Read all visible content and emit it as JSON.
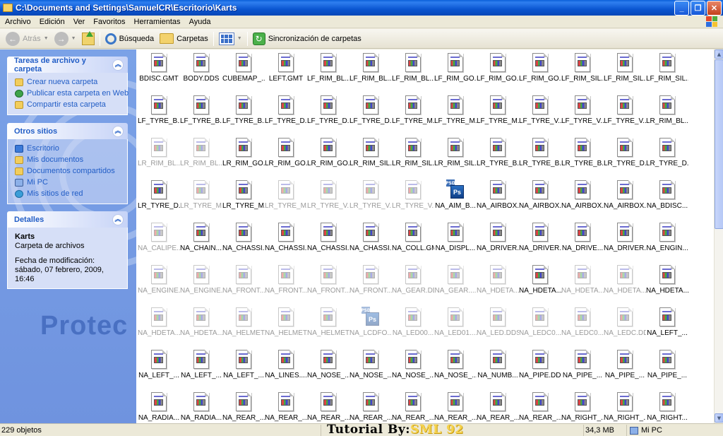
{
  "window": {
    "title": "C:\\Documents and Settings\\SamuelCR\\Escritorio\\Karts",
    "buttons": {
      "minimize": "_",
      "maximize": "❐",
      "close": "✕"
    }
  },
  "menu": [
    "Archivo",
    "Edición",
    "Ver",
    "Favoritos",
    "Herramientas",
    "Ayuda"
  ],
  "toolbar": {
    "back": "Atrás",
    "search": "Búsqueda",
    "folders": "Carpetas",
    "sync": "Sincronización de carpetas"
  },
  "taskpane": {
    "tasks": {
      "title": "Tareas de archivo y carpeta",
      "links": [
        "Crear nueva carpeta",
        "Publicar esta carpeta en Web",
        "Compartir esta carpeta"
      ]
    },
    "places": {
      "title": "Otros sitios",
      "links": [
        "Escritorio",
        "Mis documentos",
        "Documentos compartidos",
        "Mi PC",
        "Mis sitios de red"
      ]
    },
    "details": {
      "title": "Detalles",
      "name": "Karts",
      "type": "Carpeta de archivos",
      "modified": "Fecha de modificación: sábado, 07 febrero, 2009, 16:46"
    },
    "watermark": "Protec"
  },
  "files": [
    {
      "name": "BDISC.GMT",
      "icon": "doc"
    },
    {
      "name": "BODY.DDS",
      "icon": "doc"
    },
    {
      "name": "CUBEMAP_...",
      "icon": "doc"
    },
    {
      "name": "LEFT.GMT",
      "icon": "doc"
    },
    {
      "name": "LF_RIM_BL...",
      "icon": "doc"
    },
    {
      "name": "LF_RIM_BL...",
      "icon": "doc"
    },
    {
      "name": "LF_RIM_BL...",
      "icon": "doc"
    },
    {
      "name": "LF_RIM_GO...",
      "icon": "doc"
    },
    {
      "name": "LF_RIM_GO...",
      "icon": "doc"
    },
    {
      "name": "LF_RIM_GO...",
      "icon": "doc"
    },
    {
      "name": "LF_RIM_SIL...",
      "icon": "doc"
    },
    {
      "name": "LF_RIM_SIL...",
      "icon": "doc"
    },
    {
      "name": "LF_RIM_SIL...",
      "icon": "doc"
    },
    {
      "name": "LF_TYRE_B...",
      "icon": "doc"
    },
    {
      "name": "LF_TYRE_B...",
      "icon": "doc"
    },
    {
      "name": "LF_TYRE_B...",
      "icon": "doc"
    },
    {
      "name": "LF_TYRE_D...",
      "icon": "doc"
    },
    {
      "name": "LF_TYRE_D...",
      "icon": "doc"
    },
    {
      "name": "LF_TYRE_D...",
      "icon": "doc"
    },
    {
      "name": "LF_TYRE_M...",
      "icon": "doc"
    },
    {
      "name": "LF_TYRE_M...",
      "icon": "doc"
    },
    {
      "name": "LF_TYRE_M...",
      "icon": "doc"
    },
    {
      "name": "LF_TYRE_V...",
      "icon": "doc"
    },
    {
      "name": "LF_TYRE_V...",
      "icon": "doc"
    },
    {
      "name": "LF_TYRE_V...",
      "icon": "doc"
    },
    {
      "name": "LR_RIM_BL...",
      "icon": "doc"
    },
    {
      "name": "LR_RIM_BL...",
      "icon": "doc",
      "faded": true
    },
    {
      "name": "LR_RIM_BL...",
      "icon": "doc",
      "faded": true
    },
    {
      "name": "LR_RIM_GO...",
      "icon": "doc"
    },
    {
      "name": "LR_RIM_GO...",
      "icon": "doc"
    },
    {
      "name": "LR_RIM_GO...",
      "icon": "doc"
    },
    {
      "name": "LR_RIM_SIL...",
      "icon": "doc"
    },
    {
      "name": "LR_RIM_SIL...",
      "icon": "doc"
    },
    {
      "name": "LR_RIM_SIL...",
      "icon": "doc"
    },
    {
      "name": "LR_TYRE_B...",
      "icon": "doc"
    },
    {
      "name": "LR_TYRE_B...",
      "icon": "doc"
    },
    {
      "name": "LR_TYRE_B...",
      "icon": "doc"
    },
    {
      "name": "LR_TYRE_D...",
      "icon": "doc"
    },
    {
      "name": "LR_TYRE_D...",
      "icon": "doc"
    },
    {
      "name": "LR_TYRE_D...",
      "icon": "doc"
    },
    {
      "name": "LR_TYRE_M...",
      "icon": "doc",
      "faded": true
    },
    {
      "name": "LR_TYRE_M...",
      "icon": "doc"
    },
    {
      "name": "LR_TYRE_M...",
      "icon": "doc",
      "faded": true
    },
    {
      "name": "LR_TYRE_V...",
      "icon": "doc",
      "faded": true
    },
    {
      "name": "LR_TYRE_V...",
      "icon": "doc",
      "faded": true
    },
    {
      "name": "LR_TYRE_V...",
      "icon": "doc",
      "faded": true
    },
    {
      "name": "NA_AIM_B...",
      "icon": "ps"
    },
    {
      "name": "NA_AIRBOX...",
      "icon": "doc"
    },
    {
      "name": "NA_AIRBOX...",
      "icon": "doc"
    },
    {
      "name": "NA_AIRBOX...",
      "icon": "doc"
    },
    {
      "name": "NA_AIRBOX...",
      "icon": "doc"
    },
    {
      "name": "NA_BDISC...",
      "icon": "doc"
    },
    {
      "name": "NA_CALIPE...",
      "icon": "doc",
      "faded": true
    },
    {
      "name": "NA_CHAIN....",
      "icon": "doc"
    },
    {
      "name": "NA_CHASSI...",
      "icon": "doc"
    },
    {
      "name": "NA_CHASSI...",
      "icon": "doc"
    },
    {
      "name": "NA_CHASSI...",
      "icon": "doc"
    },
    {
      "name": "NA_CHASSI...",
      "icon": "doc"
    },
    {
      "name": "NA_COLL.GMT",
      "icon": "doc"
    },
    {
      "name": "NA_DISPL...",
      "icon": "doc"
    },
    {
      "name": "NA_DRIVER...",
      "icon": "doc"
    },
    {
      "name": "NA_DRIVER...",
      "icon": "doc"
    },
    {
      "name": "NA_DRIVE...",
      "icon": "doc"
    },
    {
      "name": "NA_DRIVER...",
      "icon": "doc"
    },
    {
      "name": "NA_ENGIN...",
      "icon": "doc"
    },
    {
      "name": "NA_ENGINE...",
      "icon": "doc",
      "faded": true
    },
    {
      "name": "NA_ENGINE...",
      "icon": "doc",
      "faded": true
    },
    {
      "name": "NA_FRONT...",
      "icon": "doc",
      "faded": true
    },
    {
      "name": "NA_FRONT...",
      "icon": "doc",
      "faded": true
    },
    {
      "name": "NA_FRONT...",
      "icon": "doc",
      "faded": true
    },
    {
      "name": "NA_FRONT...",
      "icon": "doc",
      "faded": true
    },
    {
      "name": "NA_GEAR.DDS",
      "icon": "doc",
      "faded": true
    },
    {
      "name": "NA_GEAR....",
      "icon": "doc",
      "faded": true
    },
    {
      "name": "NA_HDETA...",
      "icon": "doc",
      "faded": true
    },
    {
      "name": "NA_HDETA...",
      "icon": "doc"
    },
    {
      "name": "NA_HDETA...",
      "icon": "doc",
      "faded": true
    },
    {
      "name": "NA_HDETA...",
      "icon": "doc",
      "faded": true
    },
    {
      "name": "NA_HDETA...",
      "icon": "doc"
    },
    {
      "name": "NA_HDETA...",
      "icon": "doc",
      "faded": true
    },
    {
      "name": "NA_HDETA...",
      "icon": "doc",
      "faded": true
    },
    {
      "name": "NA_HELMET...",
      "icon": "doc",
      "faded": true
    },
    {
      "name": "NA_HELMET...",
      "icon": "doc",
      "faded": true
    },
    {
      "name": "NA_HELMET...",
      "icon": "doc",
      "faded": true
    },
    {
      "name": "NA_LCDFO...",
      "icon": "ps",
      "faded": true
    },
    {
      "name": "NA_LED00...",
      "icon": "doc",
      "faded": true
    },
    {
      "name": "NA_LED01....",
      "icon": "doc",
      "faded": true
    },
    {
      "name": "NA_LED.DDS",
      "icon": "doc",
      "faded": true
    },
    {
      "name": "NA_LEDC0...",
      "icon": "doc",
      "faded": true
    },
    {
      "name": "NA_LEDC0...",
      "icon": "doc",
      "faded": true
    },
    {
      "name": "NA_LEDC.DDS",
      "icon": "doc",
      "faded": true
    },
    {
      "name": "NA_LEFT_...",
      "icon": "doc"
    },
    {
      "name": "NA_LEFT_...",
      "icon": "doc"
    },
    {
      "name": "NA_LEFT_...",
      "icon": "doc"
    },
    {
      "name": "NA_LEFT_...",
      "icon": "doc"
    },
    {
      "name": "NA_LINES....",
      "icon": "doc"
    },
    {
      "name": "NA_NOSE_...",
      "icon": "doc"
    },
    {
      "name": "NA_NOSE_...",
      "icon": "doc"
    },
    {
      "name": "NA_NOSE_...",
      "icon": "doc"
    },
    {
      "name": "NA_NOSE_...",
      "icon": "doc"
    },
    {
      "name": "NA_NUMB...",
      "icon": "doc"
    },
    {
      "name": "NA_PIPE.DDS",
      "icon": "doc"
    },
    {
      "name": "NA_PIPE_...",
      "icon": "doc"
    },
    {
      "name": "NA_PIPE_...",
      "icon": "doc"
    },
    {
      "name": "NA_PIPE_...",
      "icon": "doc"
    },
    {
      "name": "NA_RADIA...",
      "icon": "doc"
    },
    {
      "name": "NA_RADIA...",
      "icon": "doc"
    },
    {
      "name": "NA_REAR_...",
      "icon": "doc"
    },
    {
      "name": "NA_REAR_...",
      "icon": "doc"
    },
    {
      "name": "NA_REAR_...",
      "icon": "doc"
    },
    {
      "name": "NA_REAR_...",
      "icon": "doc"
    },
    {
      "name": "NA_REAR_...",
      "icon": "doc"
    },
    {
      "name": "NA_REAR_...",
      "icon": "doc"
    },
    {
      "name": "NA_REAR_...",
      "icon": "doc"
    },
    {
      "name": "NA_REAR_...",
      "icon": "doc"
    },
    {
      "name": "NA_RIGHT_...",
      "icon": "doc"
    },
    {
      "name": "NA_RIGHT_...",
      "icon": "doc"
    },
    {
      "name": "NA_RIGHT...",
      "icon": "doc"
    }
  ],
  "status": {
    "count": "229 objetos",
    "overlay_prefix": "Tutorial By:",
    "overlay_author": "SML 92",
    "size": "34,3 MB",
    "location": "Mi PC"
  }
}
